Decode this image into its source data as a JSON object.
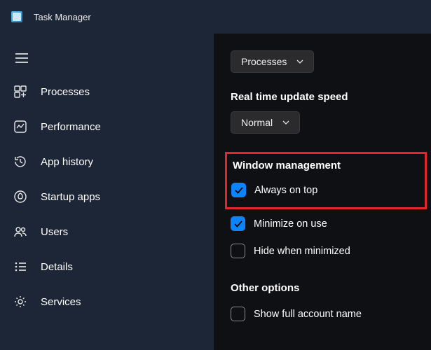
{
  "titlebar": {
    "app_title": "Task Manager"
  },
  "sidebar": {
    "items": [
      {
        "label": "Processes",
        "icon": "processes"
      },
      {
        "label": "Performance",
        "icon": "performance"
      },
      {
        "label": "App history",
        "icon": "history"
      },
      {
        "label": "Startup apps",
        "icon": "startup"
      },
      {
        "label": "Users",
        "icon": "users"
      },
      {
        "label": "Details",
        "icon": "details"
      },
      {
        "label": "Services",
        "icon": "services"
      }
    ]
  },
  "settings": {
    "default_page": {
      "selected": "Processes"
    },
    "update_speed": {
      "title": "Real time update speed",
      "selected": "Normal"
    },
    "window_mgmt": {
      "title": "Window management",
      "options": [
        {
          "label": "Always on top",
          "checked": true
        },
        {
          "label": "Minimize on use",
          "checked": true
        },
        {
          "label": "Hide when minimized",
          "checked": false
        }
      ]
    },
    "other": {
      "title": "Other options",
      "options": [
        {
          "label": "Show full account name",
          "checked": false
        }
      ]
    }
  }
}
